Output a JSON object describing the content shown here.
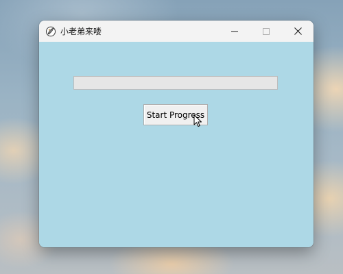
{
  "window": {
    "title": "小老弟来喽",
    "app_icon": "feather-quill-icon",
    "controls": {
      "minimize_icon": "minimize-icon",
      "maximize_icon": "maximize-icon",
      "close_icon": "close-icon"
    }
  },
  "client": {
    "background_color": "#add8e6",
    "progress": {
      "value_fraction": 0
    },
    "start_button": {
      "label": "Start Progress"
    }
  },
  "cursor": {
    "icon": "arrow-cursor-icon"
  }
}
